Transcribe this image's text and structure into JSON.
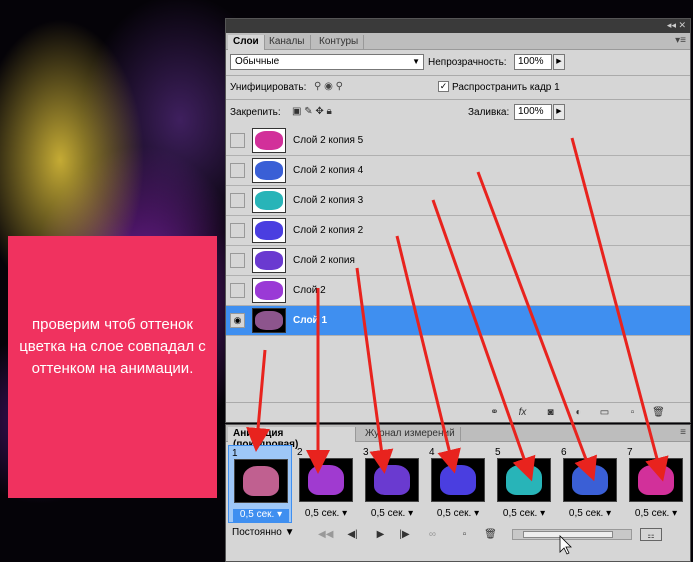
{
  "overlay_text": "проверим чтоб оттенок цветка на слое совпадал с оттенком на анимации.",
  "layers_panel": {
    "tabs": [
      "Слои",
      "Каналы",
      "Контуры"
    ],
    "blend_mode": "Обычные",
    "opacity_label": "Непрозрачность:",
    "opacity_value": "100%",
    "unify_label": "Унифицировать:",
    "propagate_label": "Распространить кадр 1",
    "propagate_checked": "✓",
    "lock_label": "Закрепить:",
    "fill_label": "Заливка:",
    "fill_value": "100%",
    "layers": [
      {
        "name": "Слой 2 копия 5",
        "color": "#d2309a"
      },
      {
        "name": "Слой 2 копия 4",
        "color": "#3a5fd6"
      },
      {
        "name": "Слой 2 копия 3",
        "color": "#28b4b8"
      },
      {
        "name": "Слой 2 копия 2",
        "color": "#4a3ee0"
      },
      {
        "name": "Слой 2 копия",
        "color": "#6a3ad0"
      },
      {
        "name": "Слой 2",
        "color": "#9a3ad6"
      },
      {
        "name": "Слой 1",
        "color": "#b06ab0",
        "selected": true
      }
    ]
  },
  "animation_panel": {
    "tabs": [
      "Анимация (покадровая)",
      "Журнал измерений"
    ],
    "frames": [
      {
        "num": "1",
        "delay": "0,5 сек.",
        "color": "#c06090"
      },
      {
        "num": "2",
        "delay": "0,5 сек.",
        "color": "#a03ad0"
      },
      {
        "num": "3",
        "delay": "0,5 сек.",
        "color": "#6a3ad0"
      },
      {
        "num": "4",
        "delay": "0,5 сек.",
        "color": "#4a3ee0"
      },
      {
        "num": "5",
        "delay": "0,5 сек.",
        "color": "#28b4b8"
      },
      {
        "num": "6",
        "delay": "0,5 сек.",
        "color": "#3a5fd6"
      },
      {
        "num": "7",
        "delay": "0,5 сек.",
        "color": "#d2309a"
      }
    ],
    "loop_value": "Постоянно"
  }
}
